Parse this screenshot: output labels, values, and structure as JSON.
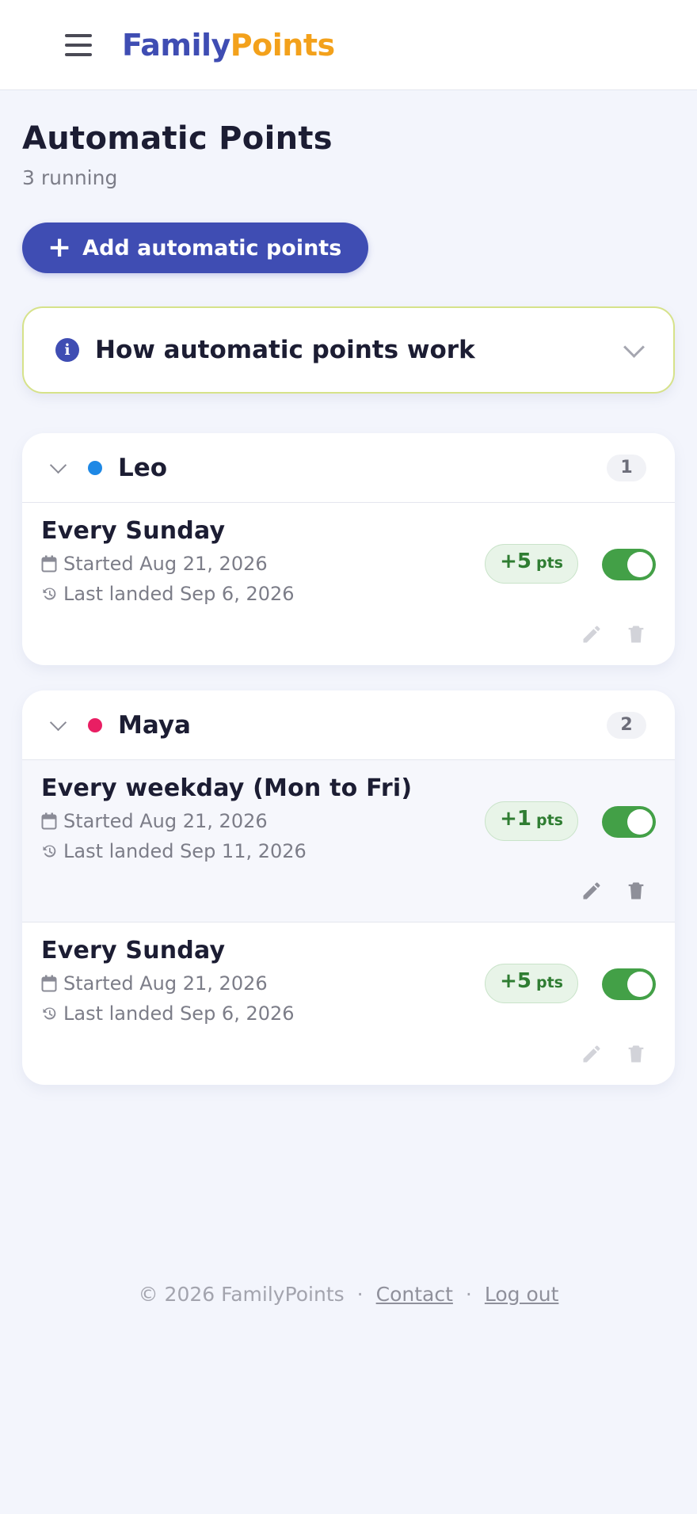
{
  "brand": {
    "part1": "Family",
    "part2": "Points"
  },
  "page": {
    "title": "Automatic Points",
    "subtitle": "3 running"
  },
  "add_button": {
    "label": "Add automatic points",
    "icon": "plus-icon"
  },
  "info_panel": {
    "title": "How automatic points work",
    "icon": "info-icon"
  },
  "groups": [
    {
      "name": "Leo",
      "color": "#1e88e5",
      "count": "1",
      "rules": [
        {
          "title": "Every Sunday",
          "started": "Started Aug 21, 2026",
          "last_landed": "Last landed Sep 6, 2026",
          "points": "+5",
          "unit": "pts",
          "enabled": true
        }
      ]
    },
    {
      "name": "Maya",
      "color": "#e91e63",
      "count": "2",
      "rules": [
        {
          "title": "Every weekday (Mon to Fri)",
          "started": "Started Aug 21, 2026",
          "last_landed": "Last landed Sep 11, 2026",
          "points": "+1",
          "unit": "pts",
          "enabled": true
        },
        {
          "title": "Every Sunday",
          "started": "Started Aug 21, 2026",
          "last_landed": "Last landed Sep 6, 2026",
          "points": "+5",
          "unit": "pts",
          "enabled": true
        }
      ]
    }
  ],
  "footer": {
    "copyright": "© 2026 FamilyPoints",
    "separator": "·",
    "contact": "Contact",
    "logout": "Log out"
  },
  "colors": {
    "primary": "#3f4db3",
    "accent": "#f3a11b",
    "toggle_on": "#43a047",
    "points_text": "#2f7d32"
  }
}
